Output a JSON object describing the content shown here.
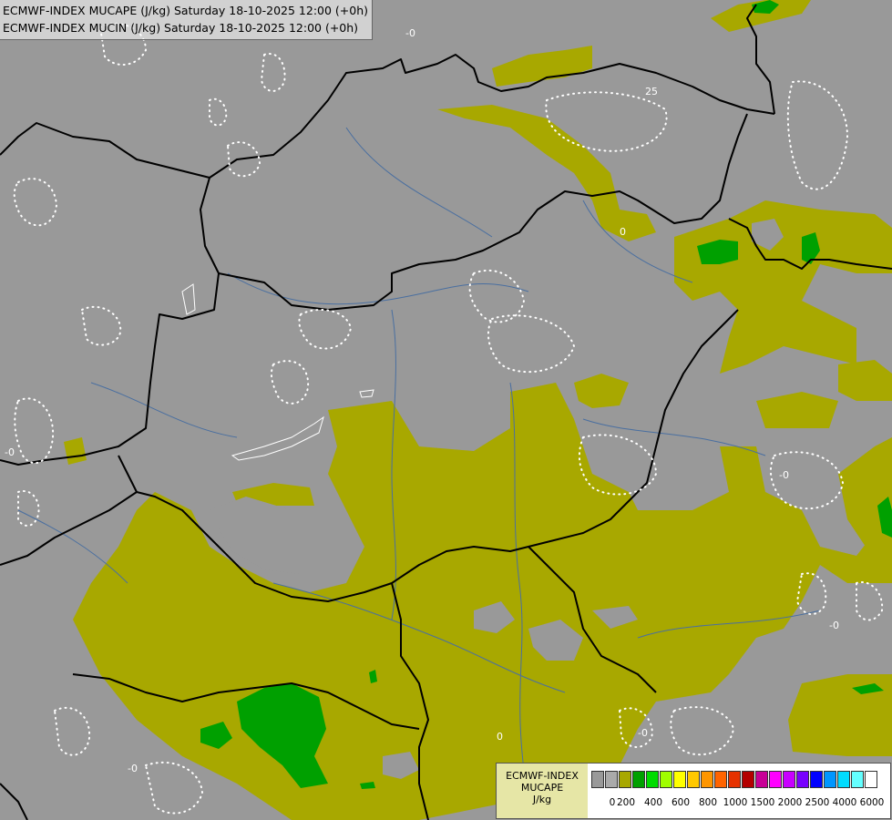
{
  "title": {
    "line1": "ECMWF-INDEX MUCAPE (J/kg) Saturday 18-10-2025 12:00 (+0h)",
    "line2": "ECMWF-INDEX MUCIN (J/kg) Saturday 18-10-2025 12:00 (+0h)"
  },
  "legend": {
    "line1": "ECMWF-INDEX",
    "line2": "MUCAPE",
    "line3": "J/kg",
    "colors": [
      "#999999",
      "#aaaaaa",
      "#a8a800",
      "#00a000",
      "#00dc00",
      "#a0ff00",
      "#ffff00",
      "#ffc800",
      "#ff9600",
      "#ff6400",
      "#e63200",
      "#b40000",
      "#c80096",
      "#ff00ff",
      "#c800ff",
      "#7800ff",
      "#0000ff",
      "#0096ff",
      "#00dcff",
      "#64ffff",
      "#ffffff"
    ],
    "ticks": [
      "0",
      "200",
      "400",
      "600",
      "800",
      "1000",
      "1500",
      "2000",
      "2500",
      "4000",
      "6000"
    ]
  },
  "map_labels": [
    "-0",
    "0",
    "25",
    "-0",
    "-0",
    "0",
    "-0",
    "-0",
    "-0"
  ],
  "colors": {
    "background": "#999999",
    "cape_low": "#a8a800",
    "cape_mid": "#00a000",
    "border": "#000000",
    "river": "#4a6fa0",
    "cin_contour": "#ffffff"
  }
}
